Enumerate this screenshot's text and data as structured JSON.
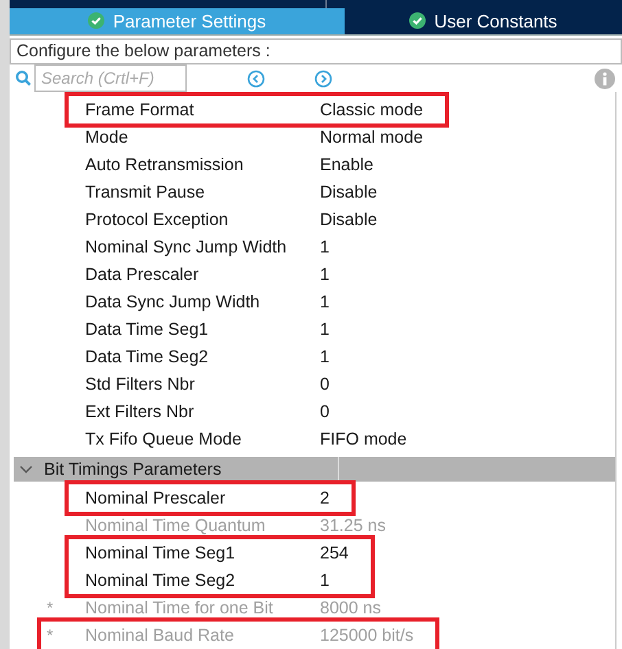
{
  "tabs": [
    {
      "label": "Parameter Settings",
      "selected": true
    },
    {
      "label": "User Constants",
      "selected": false
    }
  ],
  "instruction": "Configure the below parameters :",
  "search": {
    "placeholder": "Search (Crtl+F)"
  },
  "rows": [
    {
      "label": "Frame Format",
      "value": "Classic mode",
      "disabled": false,
      "highlighted": true
    },
    {
      "label": "Mode",
      "value": "Normal mode",
      "disabled": false,
      "highlighted": false
    },
    {
      "label": "Auto Retransmission",
      "value": "Enable",
      "disabled": false,
      "highlighted": false
    },
    {
      "label": "Transmit Pause",
      "value": "Disable",
      "disabled": false,
      "highlighted": false
    },
    {
      "label": "Protocol Exception",
      "value": "Disable",
      "disabled": false,
      "highlighted": false
    },
    {
      "label": "Nominal Sync Jump Width",
      "value": "1",
      "disabled": false,
      "highlighted": false
    },
    {
      "label": "Data Prescaler",
      "value": "1",
      "disabled": false,
      "highlighted": false
    },
    {
      "label": "Data Sync Jump Width",
      "value": "1",
      "disabled": false,
      "highlighted": false
    },
    {
      "label": "Data Time Seg1",
      "value": "1",
      "disabled": false,
      "highlighted": false
    },
    {
      "label": "Data Time Seg2",
      "value": "1",
      "disabled": false,
      "highlighted": false
    },
    {
      "label": "Std Filters Nbr",
      "value": "0",
      "disabled": false,
      "highlighted": false
    },
    {
      "label": "Ext Filters Nbr",
      "value": "0",
      "disabled": false,
      "highlighted": false
    },
    {
      "label": "Tx Fifo Queue Mode",
      "value": "FIFO mode",
      "disabled": false,
      "highlighted": false
    }
  ],
  "section": {
    "title": "Bit Timings Parameters",
    "expanded": true,
    "rows": [
      {
        "label": "Nominal Prescaler",
        "value": "2",
        "disabled": false,
        "highlighted": true
      },
      {
        "label": "Nominal Time Quantum",
        "value": "31.25 ns",
        "disabled": true,
        "highlighted": false
      },
      {
        "label": "Nominal Time Seg1",
        "value": "254",
        "disabled": false,
        "highlighted": true
      },
      {
        "label": "Nominal Time Seg2",
        "value": "1",
        "disabled": false,
        "highlighted": true
      },
      {
        "label": "Nominal Time for one Bit",
        "value": "8000 ns",
        "disabled": true,
        "highlighted": false,
        "marker": "*"
      },
      {
        "label": "Nominal Baud Rate",
        "value": "125000 bit/s",
        "disabled": true,
        "highlighted": true,
        "marker": "*"
      }
    ]
  }
}
